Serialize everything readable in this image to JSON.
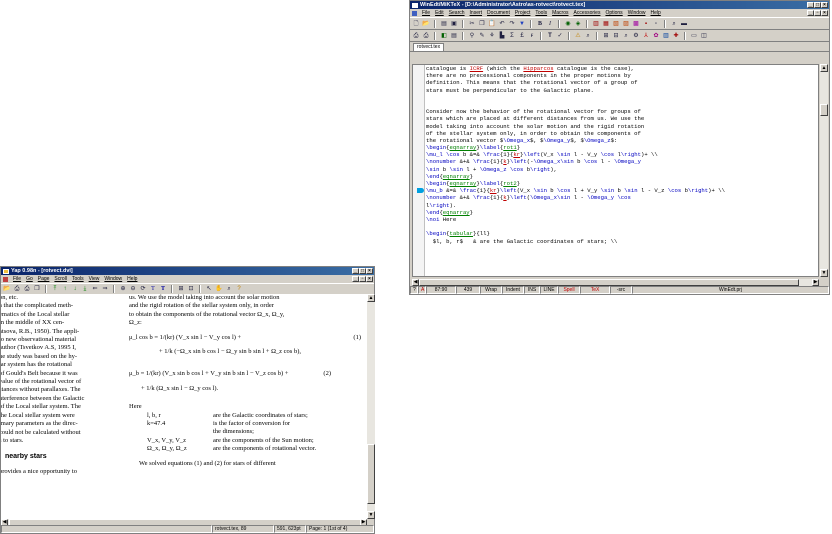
{
  "yap": {
    "title": "Yap 0.98n - [rotvect.dvi]",
    "menu": [
      "File",
      "Go",
      "Page",
      "Scroll",
      "Tools",
      "View",
      "Window",
      "Help"
    ],
    "left_lines": [
      "on, etc.",
      "a that the complicated meth-",
      "ematics of the Local stellar",
      "in the middle of XX cen-",
      "atsova, R.B., 1950). The appli-",
      "to new observational material",
      "author (Tsvetkov A.S, 1995 I,",
      "he study was based on the hy-",
      "lar system has the rotational",
      "of Gould's Belt because it was",
      "value of the rotational vector of",
      "stances without parallaxes. The",
      "nterference between the Galactic",
      "of the Local stellar system. The",
      "the Local stellar system were",
      "imary parameters as the direc-",
      "could not be calculated without",
      "s to stars."
    ],
    "left_heading": "nearby stars",
    "left_bottom": "provides a nice opportunity to",
    "right_lines": [
      "us. We use the model taking into account the solar motion",
      "and the rigid rotation of the stellar system only, in order",
      "to obtain the components of the rotational vector Ω_x, Ω_y,",
      "Ω_z:"
    ],
    "eq1a": "μ_l cos b  =  1/(kr) (V_x sin l − V_y cos l) +",
    "eq1b": "+  1/k (−Ω_x sin b cos l − Ω_y sin b sin l + Ω_z cos b),",
    "eq1_no": "(1)",
    "eq2a": "μ_b  =  1/(kr) (V_x sin b cos l + V_y sin b sin l − V_z cos b) +",
    "eq2b": "+  1/k (Ω_x sin l − Ω_y cos l).",
    "eq2_no": "(2)",
    "here": "Here",
    "defs": [
      {
        "term": "l, b, r",
        "desc": "are the Galactic coordinates of stars;"
      },
      {
        "term": "k=47.4",
        "desc": "is the factor of conversion for"
      },
      {
        "term": "",
        "desc": "the dimensions;"
      },
      {
        "term": "V_x, V_y, V_z",
        "desc": "are the components of the Sun motion;"
      },
      {
        "term": "Ω_x, Ω_y, Ω_z",
        "desc": "are the components of rotational vector."
      }
    ],
    "right_bottom": "We solved equations (1) and (2) for stars of different",
    "status": [
      "rotvect.tex, 89",
      "591, 623pt",
      "Page: 1 (1st of 4)"
    ]
  },
  "winedt": {
    "title": "WinEdt/MiKTeX - [D:\\Administrator\\Astro\\as-rotvect\\rotvect.tex]",
    "menu": [
      "File",
      "Edit",
      "Search",
      "Insert",
      "Document",
      "Project",
      "Tools",
      "Macros",
      "Accessories",
      "Options",
      "Window",
      "Help"
    ],
    "tab": "rotvect.tex",
    "code": [
      "catalogue is ICRF (which the Hipparcos catalogue is the case),",
      "there are no precessional components in the proper motions by",
      "definition. This means that the rotational vector of a group of",
      "stars must be perpendicular to the Galactic plane.",
      "",
      "",
      "Consider now the behavior of the rotational vector for groups of",
      "stars which are placed at different distances from us. We use the",
      "model taking into account the solar motion and the rigid rotation",
      "of the stellar system only, in order to obtain the components of",
      "the rotational vector $\\Omega_x$, $\\Omega_y$, $\\Omega_z$:",
      "\\begin{eqnarray}\\label{rot1}",
      "\\mu_l \\cos b &=& \\frac{1}{kr}\\left(V_x \\sin l - V_y \\cos l\\right)+ \\\\",
      "\\nonumber &+& \\frac{1}{k}\\left(-\\Omega_x\\sin b \\cos l - \\Omega_y",
      "\\sin b \\sin l + \\Omega_z \\cos b\\right),",
      "\\end{eqnarray}",
      "\\begin{eqnarray}\\label{rot2}",
      "\\mu_b &=& \\frac{1}{kr}\\left(V_x \\sin b \\cos l + V_y \\sin b \\sin l - V_z \\cos b\\right)+ \\\\",
      "\\nonumber &+& \\frac{1}{k}\\left(\\Omega_x\\sin l - \\Omega_y \\cos",
      "l\\right).",
      "\\end{eqnarray}",
      "\\noi Here",
      "",
      "\\begin{tabular}{ll}",
      "  $l, b, r$   & are the Galactic coordinates of stars; \\\\"
    ],
    "status": [
      "?",
      "A",
      "87:90",
      "439",
      "Wrap",
      "Indent",
      "INS",
      "LINE",
      "Spell",
      "TeX",
      "-src",
      "WinEdt.prj"
    ]
  }
}
